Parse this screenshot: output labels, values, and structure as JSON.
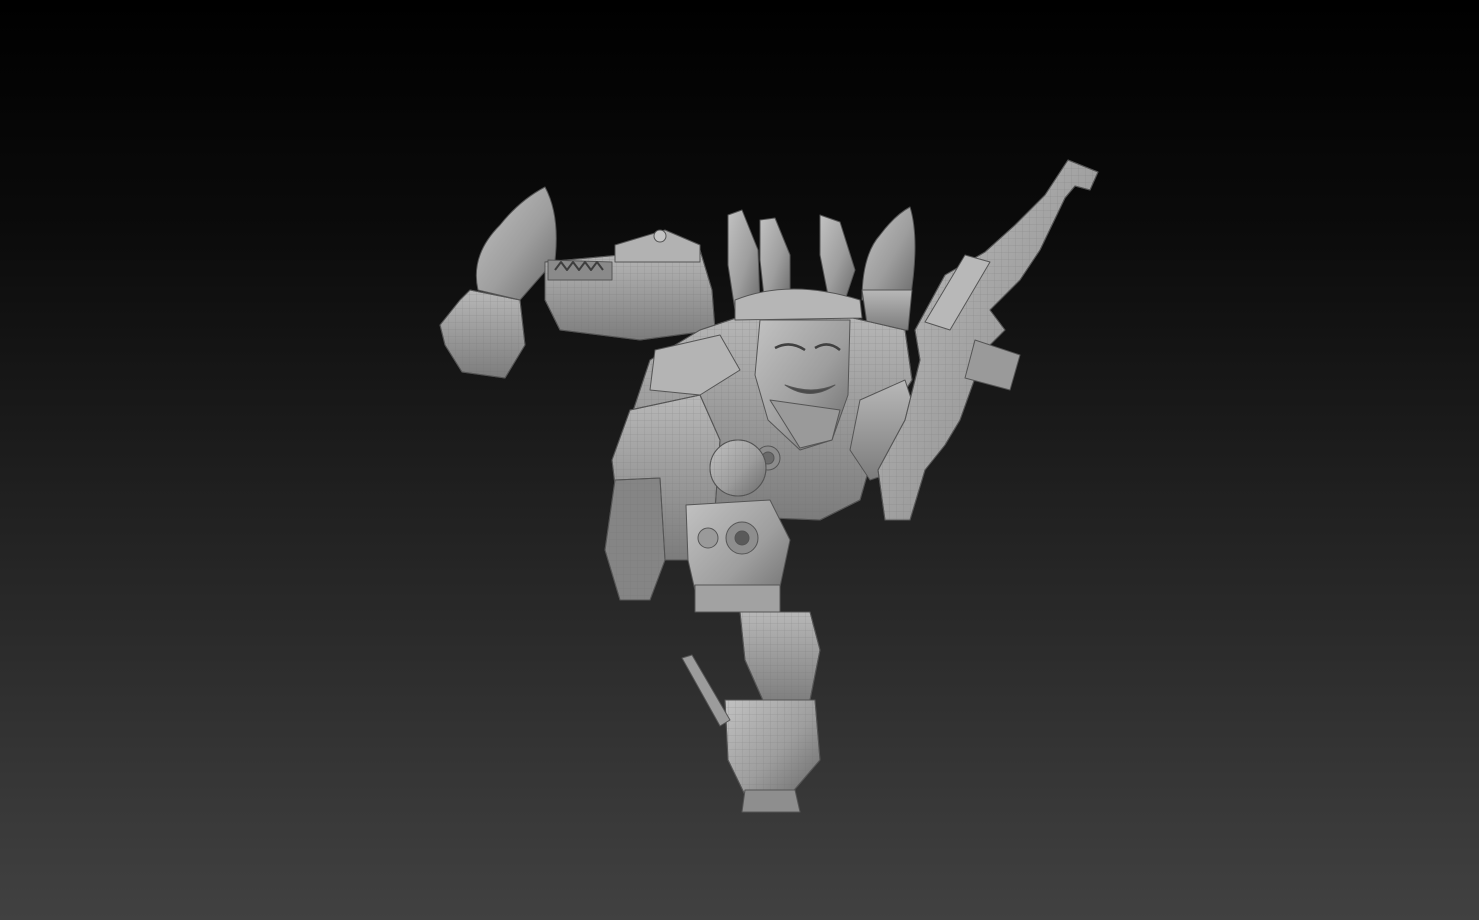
{
  "scene": {
    "subject": "sculpted-figure",
    "model_color": "#a6a6a6",
    "background_top": "#000000",
    "background_bottom": "#414141"
  }
}
